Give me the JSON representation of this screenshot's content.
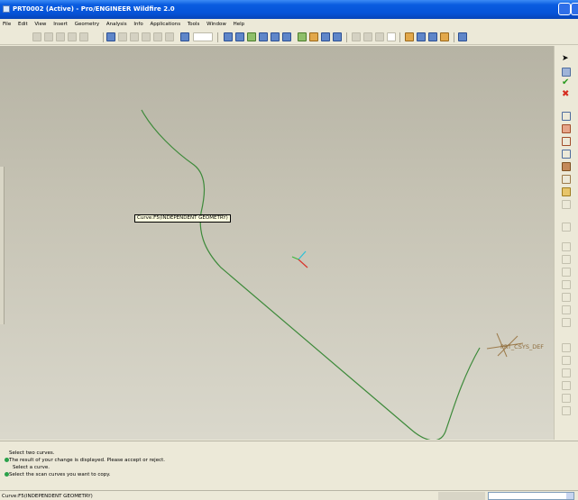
{
  "window": {
    "title": "PRT0002 (Active) - Pro/ENGINEER Wildfire 2.0"
  },
  "menu": [
    "File",
    "Edit",
    "View",
    "Insert",
    "Geometry",
    "Analysis",
    "Info",
    "Applications",
    "Tools",
    "Window",
    "Help"
  ],
  "toolbar_icons": [
    "new-icon",
    "open-icon",
    "save-icon",
    "print-icon",
    "email-icon",
    "undo-icon",
    "redo-icon",
    "cut-icon",
    "copy-icon",
    "paste-icon",
    "regenerate-icon",
    "find-icon",
    "select-box",
    "repaint-icon",
    "spin-center-icon",
    "orient-icon",
    "zoom-in-icon",
    "zoom-out-icon",
    "refit-icon",
    "reorient-icon",
    "saved-views-icon",
    "layers-icon",
    "appearance-icon",
    "shading-icon",
    "hidden-line-icon",
    "no-hidden-icon",
    "wireframe-icon",
    "datum-planes-icon",
    "datum-axes-icon",
    "datum-points-icon",
    "csys-icon",
    "whats-this-icon"
  ],
  "right_toolbar_icons": [
    "select-arrow-icon",
    "ok-icon",
    "cancel-icon",
    "curve-icon",
    "plane-icon",
    "axis-icon",
    "sketch-icon",
    "point-icon",
    "csys-icon",
    "extrude-icon",
    "revolve-icon",
    "variable-section-icon",
    "blend-icon",
    "round-icon",
    "chamfer-icon",
    "hole-icon",
    "shell-icon",
    "rib-icon",
    "draft-icon",
    "pattern-icon",
    "mirror-icon",
    "merge-icon",
    "trim-icon"
  ],
  "viewport": {
    "tooltip": "Curve:F5(INDEPENDENT GEOMETRY)",
    "csys_label": "PRT_CSYS_DEF",
    "curve_color": "#3d8a3a",
    "background": "#c6c3b4"
  },
  "messages": [
    {
      "text": "Select two curves.",
      "icon": false
    },
    {
      "text": "The result of your change is displayed. Please accept or reject.",
      "icon": true
    },
    {
      "text": "Select a curve.",
      "icon": false
    },
    {
      "text": "Select the scan curves you want to copy.",
      "icon": true
    }
  ],
  "status": {
    "text": "Curve:F5(INDEPENDENT GEOMETRY)",
    "filter_value": ""
  }
}
